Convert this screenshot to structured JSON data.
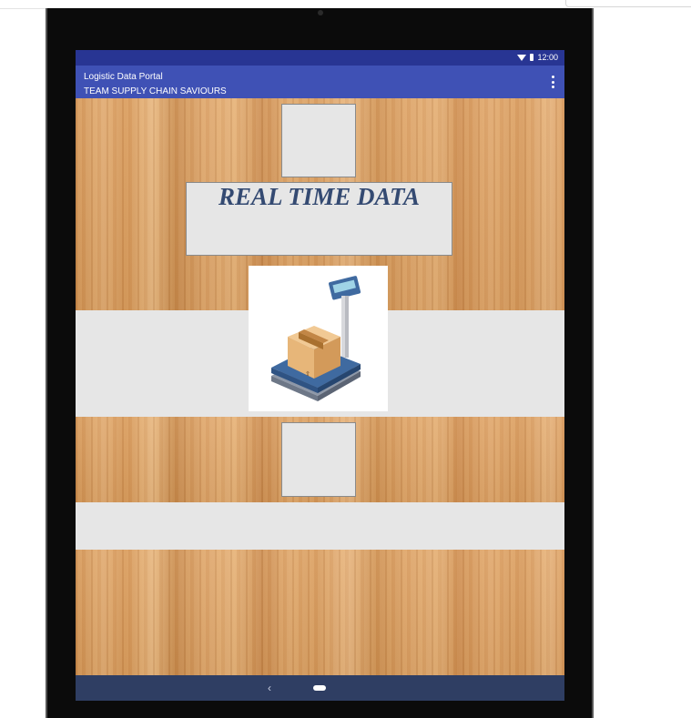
{
  "status_bar": {
    "time": "12:00",
    "wifi_icon": "wifi-icon",
    "battery_icon": "battery-icon"
  },
  "app_bar": {
    "title": "Logistic Data Portal",
    "subtitle": "TEAM SUPPLY CHAIN SAVIOURS",
    "menu_icon": "overflow-menu-icon",
    "color": "#3f51b5"
  },
  "main": {
    "banner_text": "REAL TIME DATA",
    "image": "package-on-scale-illustration"
  },
  "nav_bar": {
    "back_icon": "back-icon",
    "home_icon": "home-icon"
  },
  "colors": {
    "status_bar": "#283593",
    "app_bar": "#3f51b5",
    "nav_bar": "#2f3e63",
    "banner_text": "#344a72",
    "panel": "#e6e6e6"
  }
}
